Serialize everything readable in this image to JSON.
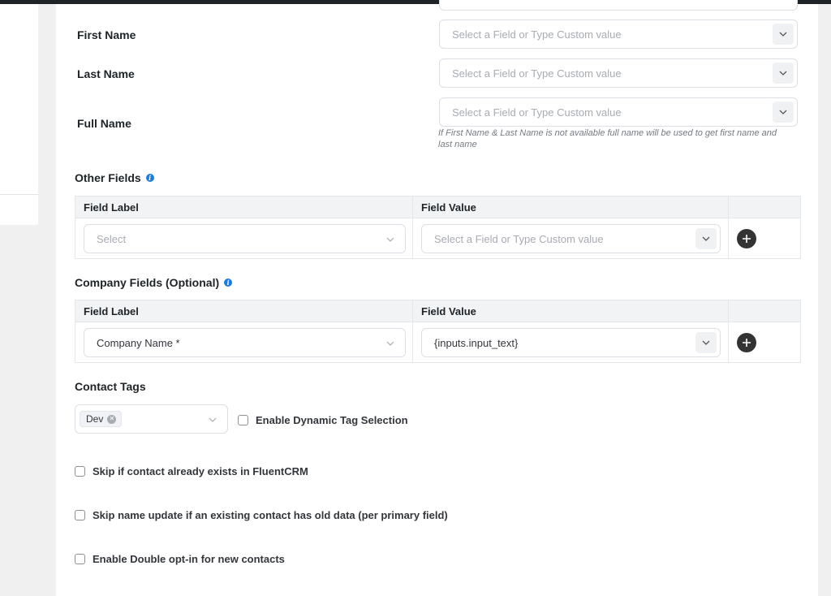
{
  "fields": {
    "first_name": {
      "label": "First Name",
      "placeholder": "Select a Field or Type Custom value"
    },
    "last_name": {
      "label": "Last Name",
      "placeholder": "Select a Field or Type Custom value"
    },
    "full_name": {
      "label": "Full Name",
      "placeholder": "Select a Field or Type Custom value",
      "help_line1": "If First Name & Last Name is not available full name will be used to get first name and",
      "help_line2": "last name"
    }
  },
  "other_fields": {
    "title": "Other Fields",
    "col_label": "Field Label",
    "col_value": "Field Value",
    "row": {
      "label_placeholder": "Select",
      "value_placeholder": "Select a Field or Type Custom value"
    }
  },
  "company_fields": {
    "title": "Company Fields (Optional)",
    "col_label": "Field Label",
    "col_value": "Field Value",
    "row": {
      "label_value": "Company Name *",
      "value_value": "{inputs.input_text}"
    }
  },
  "contact_tags": {
    "title": "Contact Tags",
    "tags": [
      "Dev"
    ],
    "dynamic_label": "Enable Dynamic Tag Selection"
  },
  "options": {
    "skip_existing": "Skip if contact already exists in FluentCRM",
    "skip_name_update": "Skip name update if an existing contact has old data (per primary field)",
    "double_optin": "Enable Double opt-in for new contacts"
  },
  "icons": {
    "chevron": "chevron-down-icon",
    "info": "info-icon",
    "plus": "plus-circle-icon",
    "close": "close-icon"
  },
  "colors": {
    "info_blue": "#1a7ae6",
    "plus_dark": "#333333"
  }
}
